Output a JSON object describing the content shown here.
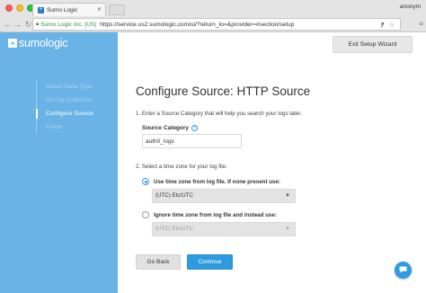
{
  "browser": {
    "tab_title": "Sumo Logic",
    "tab_favicon": "+",
    "user_label": "anonym",
    "cert_label": "Sumo Logic Inc. [US]",
    "url": "https://service.us2.sumologic.com/ui/?return_to=&provider=#section/setup",
    "icons": [
      "back-arrow-icon",
      "forward-arrow-icon",
      "reload-icon",
      "lock-icon",
      "translate-icon",
      "star-icon",
      "menu-icon"
    ]
  },
  "app": {
    "logo_text": "sumologic",
    "logo_mark": "+",
    "steps": [
      {
        "label": "Select Data Type",
        "active": false
      },
      {
        "label": "Set Up Collection",
        "active": false
      },
      {
        "label": "Configure Source",
        "active": true
      },
      {
        "label": "Finish",
        "active": false
      }
    ],
    "exit_label": "Exit Setup Wizard",
    "title": "Configure Source: HTTP Source",
    "instruction_1": "1. Enter a Source Category that will help you search your logs later.",
    "category_label": "Source Category",
    "category_help": "?",
    "category_value": "auth0_logs",
    "instruction_2": "2. Select a time zone for your log file.",
    "option_1_label": "Use time zone from log file. If none present use:",
    "option_1_value": "(UTC) Etc/UTC",
    "option_2_label": "Ignore time zone from log file and instead use:",
    "option_2_value": "(UTC) Etc/UTC",
    "back_label": "Go Back",
    "continue_label": "Continue"
  },
  "colors": {
    "sidebar": "#6ab3e6",
    "accent": "#2e9ae0",
    "secondary_button": "#e1e1e1"
  }
}
